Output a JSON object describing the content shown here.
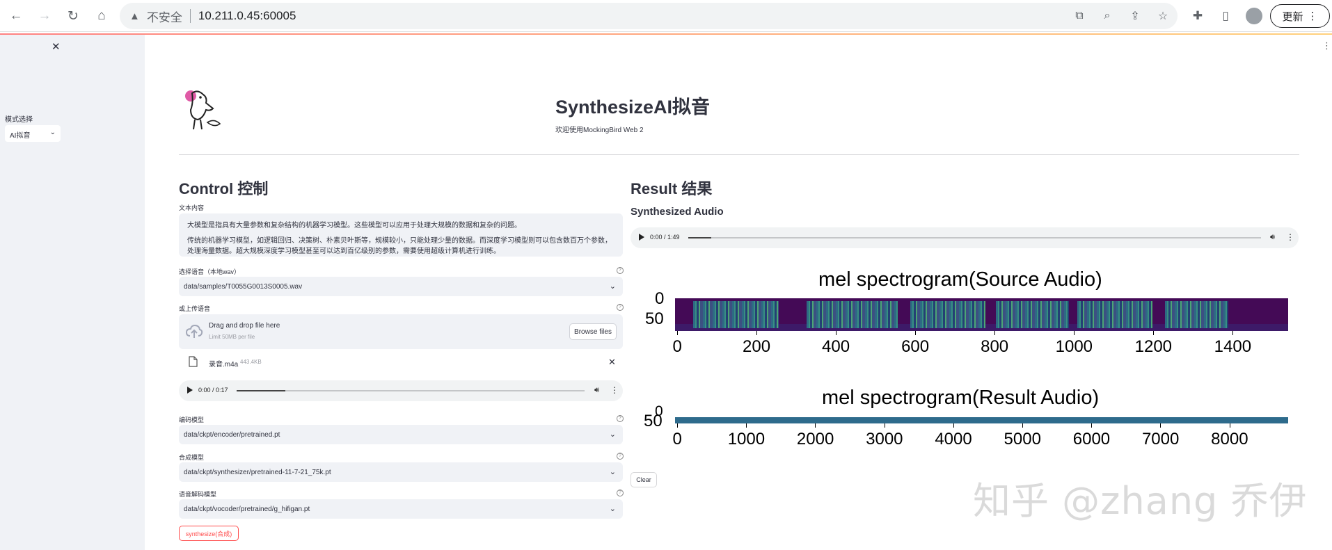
{
  "browser": {
    "security_label": "不安全",
    "url": "10.211.0.45:60005",
    "update_label": "更新"
  },
  "sidebar": {
    "mode_label": "模式选择",
    "mode_value": "AI拟音"
  },
  "header": {
    "title": "SynthesizeAI拟音",
    "subtitle": "欢迎使用MockingBird Web 2"
  },
  "control": {
    "heading": "Control 控制",
    "text_label": "文本内容",
    "text_lines": [
      "大模型是指具有大量参数和复杂结构的机器学习模型。这些模型可以应用于处理大规模的数据和复杂的问题。",
      "传统的机器学习模型，如逻辑回归、决策树、朴素贝叶斯等，规模较小，只能处理少量的数据。而深度学习模型则可以包含数百万个参数，",
      "处理海量数据。超大规模深度学习模型甚至可以达到百亿级别的参数，需要使用超级计算机进行训练。"
    ],
    "voice_label": "选择语音（本地wav）",
    "voice_value": "data/samples/T0055G0013S0005.wav",
    "upload_label": "或上传语音",
    "upload_drag": "Drag and drop file here",
    "upload_limit": "Limit 50MB per file",
    "browse_label": "Browse files",
    "file_name": "录音.m4a",
    "file_size": "443.4KB",
    "audio_time": "0:00 / 0:17",
    "audio_progress": 0.14,
    "encoder_label": "编码模型",
    "encoder_value": "data/ckpt/encoder/pretrained.pt",
    "synth_label": "合成模型",
    "synth_value": "data/ckpt/synthesizer/pretrained-11-7-21_75k.pt",
    "vocoder_label": "语音解码模型",
    "vocoder_value": "data/ckpt/vocoder/pretrained/g_hifigan.pt",
    "synthesize_button": "synthesize(合成)"
  },
  "result": {
    "heading": "Result 结果",
    "synth_audio_label": "Synthesized Audio",
    "audio_time": "0:00 / 1:49",
    "audio_progress": 0.04,
    "clear_button": "Clear"
  },
  "chart_data": [
    {
      "type": "heatmap",
      "title": "mel spectrogram(Source Audio)",
      "x_ticks": [
        "0",
        "200",
        "400",
        "600",
        "800",
        "1000",
        "1200",
        "1400"
      ],
      "y_ticks": [
        "0",
        "50"
      ],
      "xlim": [
        0,
        1540
      ],
      "ylim": [
        80,
        0
      ]
    },
    {
      "type": "heatmap",
      "title": "mel spectrogram(Result Audio)",
      "x_ticks": [
        "0",
        "1000",
        "2000",
        "3000",
        "4000",
        "5000",
        "6000",
        "7000",
        "8000"
      ],
      "y_ticks": [
        "0",
        "50"
      ],
      "xlim": [
        0,
        8850
      ],
      "ylim": [
        80,
        0
      ]
    }
  ],
  "watermark": "知乎 @zhang 乔伊"
}
